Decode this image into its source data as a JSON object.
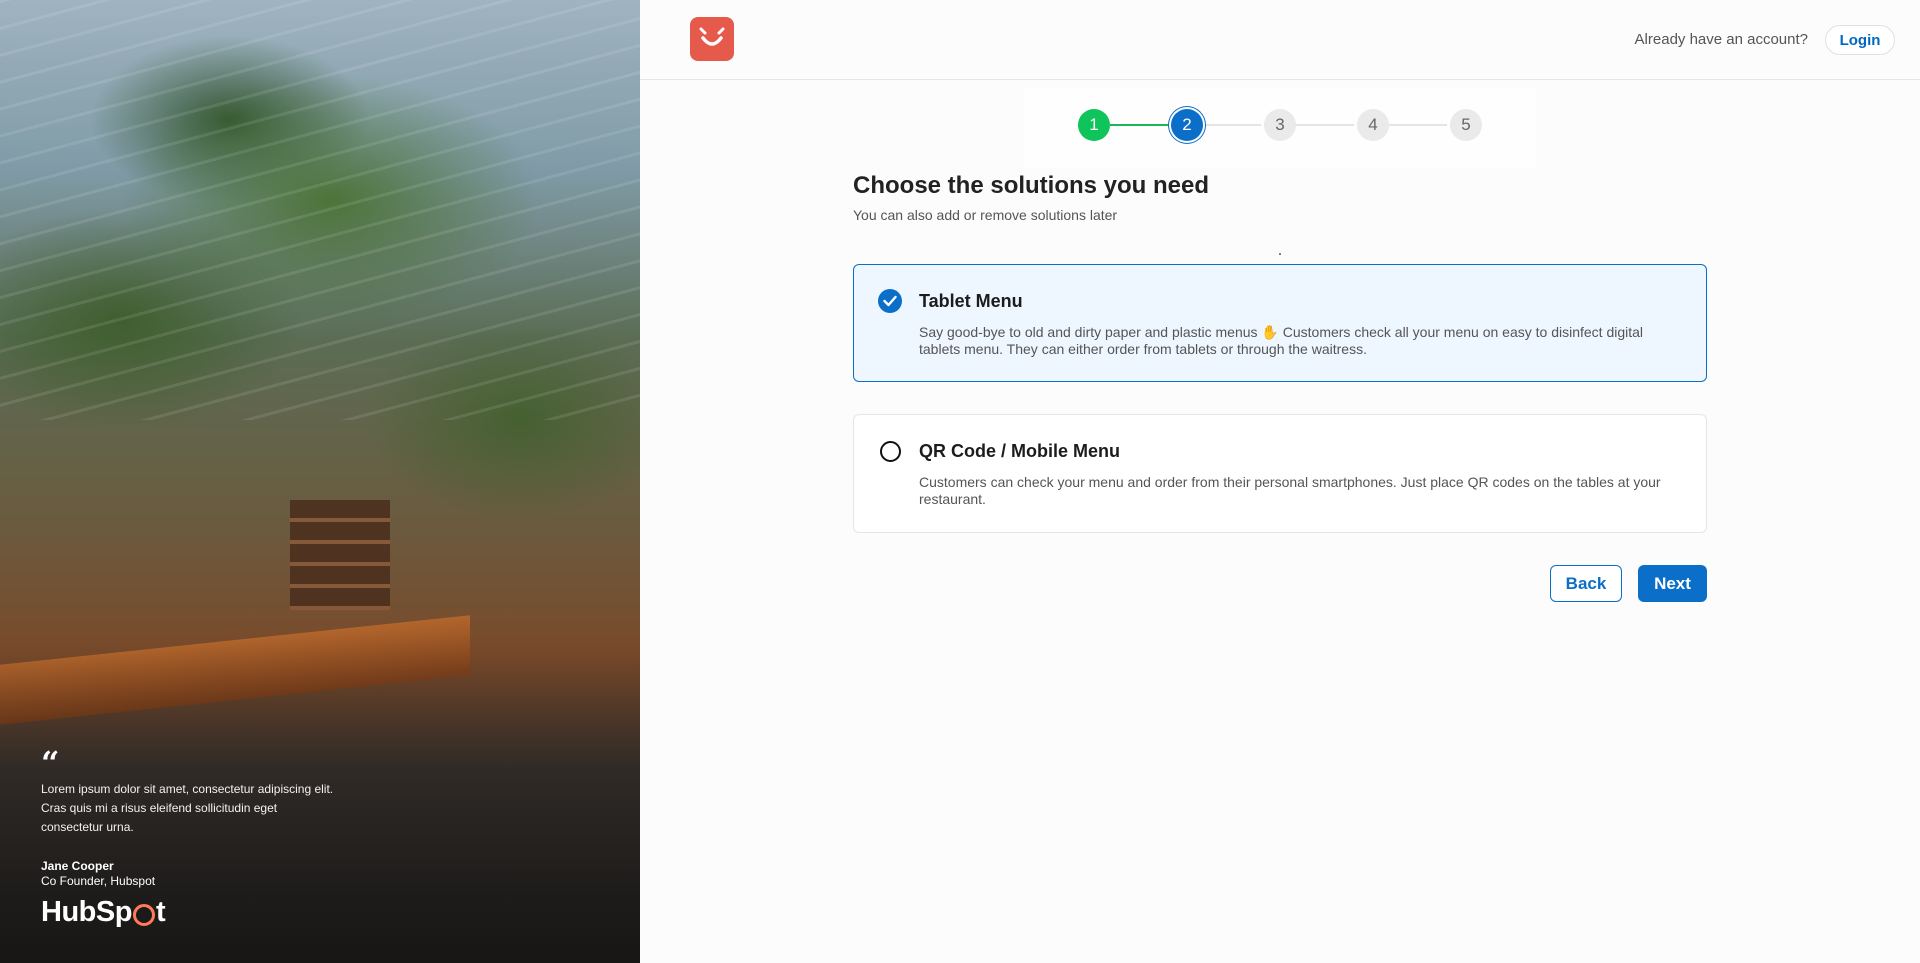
{
  "hero": {
    "quote_mark": "“",
    "quote": "Lorem ipsum dolor sit amet, consectetur adipiscing elit. Cras quis mi a risus eleifend sollicitudin eget consectetur urna.",
    "author_name": "Jane Cooper",
    "author_role": "Co Founder, Hubspot",
    "brand_logo": "HubSpot"
  },
  "header": {
    "logo_icon": "smile-logo-icon",
    "account_prompt": "Already have an account?",
    "login_label": "Login"
  },
  "stepper": {
    "current_step": 2,
    "steps": [
      "1",
      "2",
      "3",
      "4",
      "5"
    ]
  },
  "main": {
    "title": "Choose the solutions you need",
    "subtitle": "You can also add or remove solutions later",
    "options": [
      {
        "title": "Tablet Menu",
        "description": "Say good-bye to old and dirty paper and plastic menus ✋ Customers check all your menu on easy to disinfect digital tablets menu. They can either order from tablets or through the waitress.",
        "selected": true
      },
      {
        "title": "QR Code / Mobile Menu",
        "description": "Customers can check your menu and order from their personal smartphones. Just place QR codes on the tables at your restaurant.",
        "selected": false
      }
    ],
    "back_label": "Back",
    "next_label": "Next"
  },
  "colors": {
    "primary": "#0b6fc9",
    "step_done": "#10c45c",
    "logo": "#e55a4a",
    "hubspot_accent": "#ff7a59"
  }
}
